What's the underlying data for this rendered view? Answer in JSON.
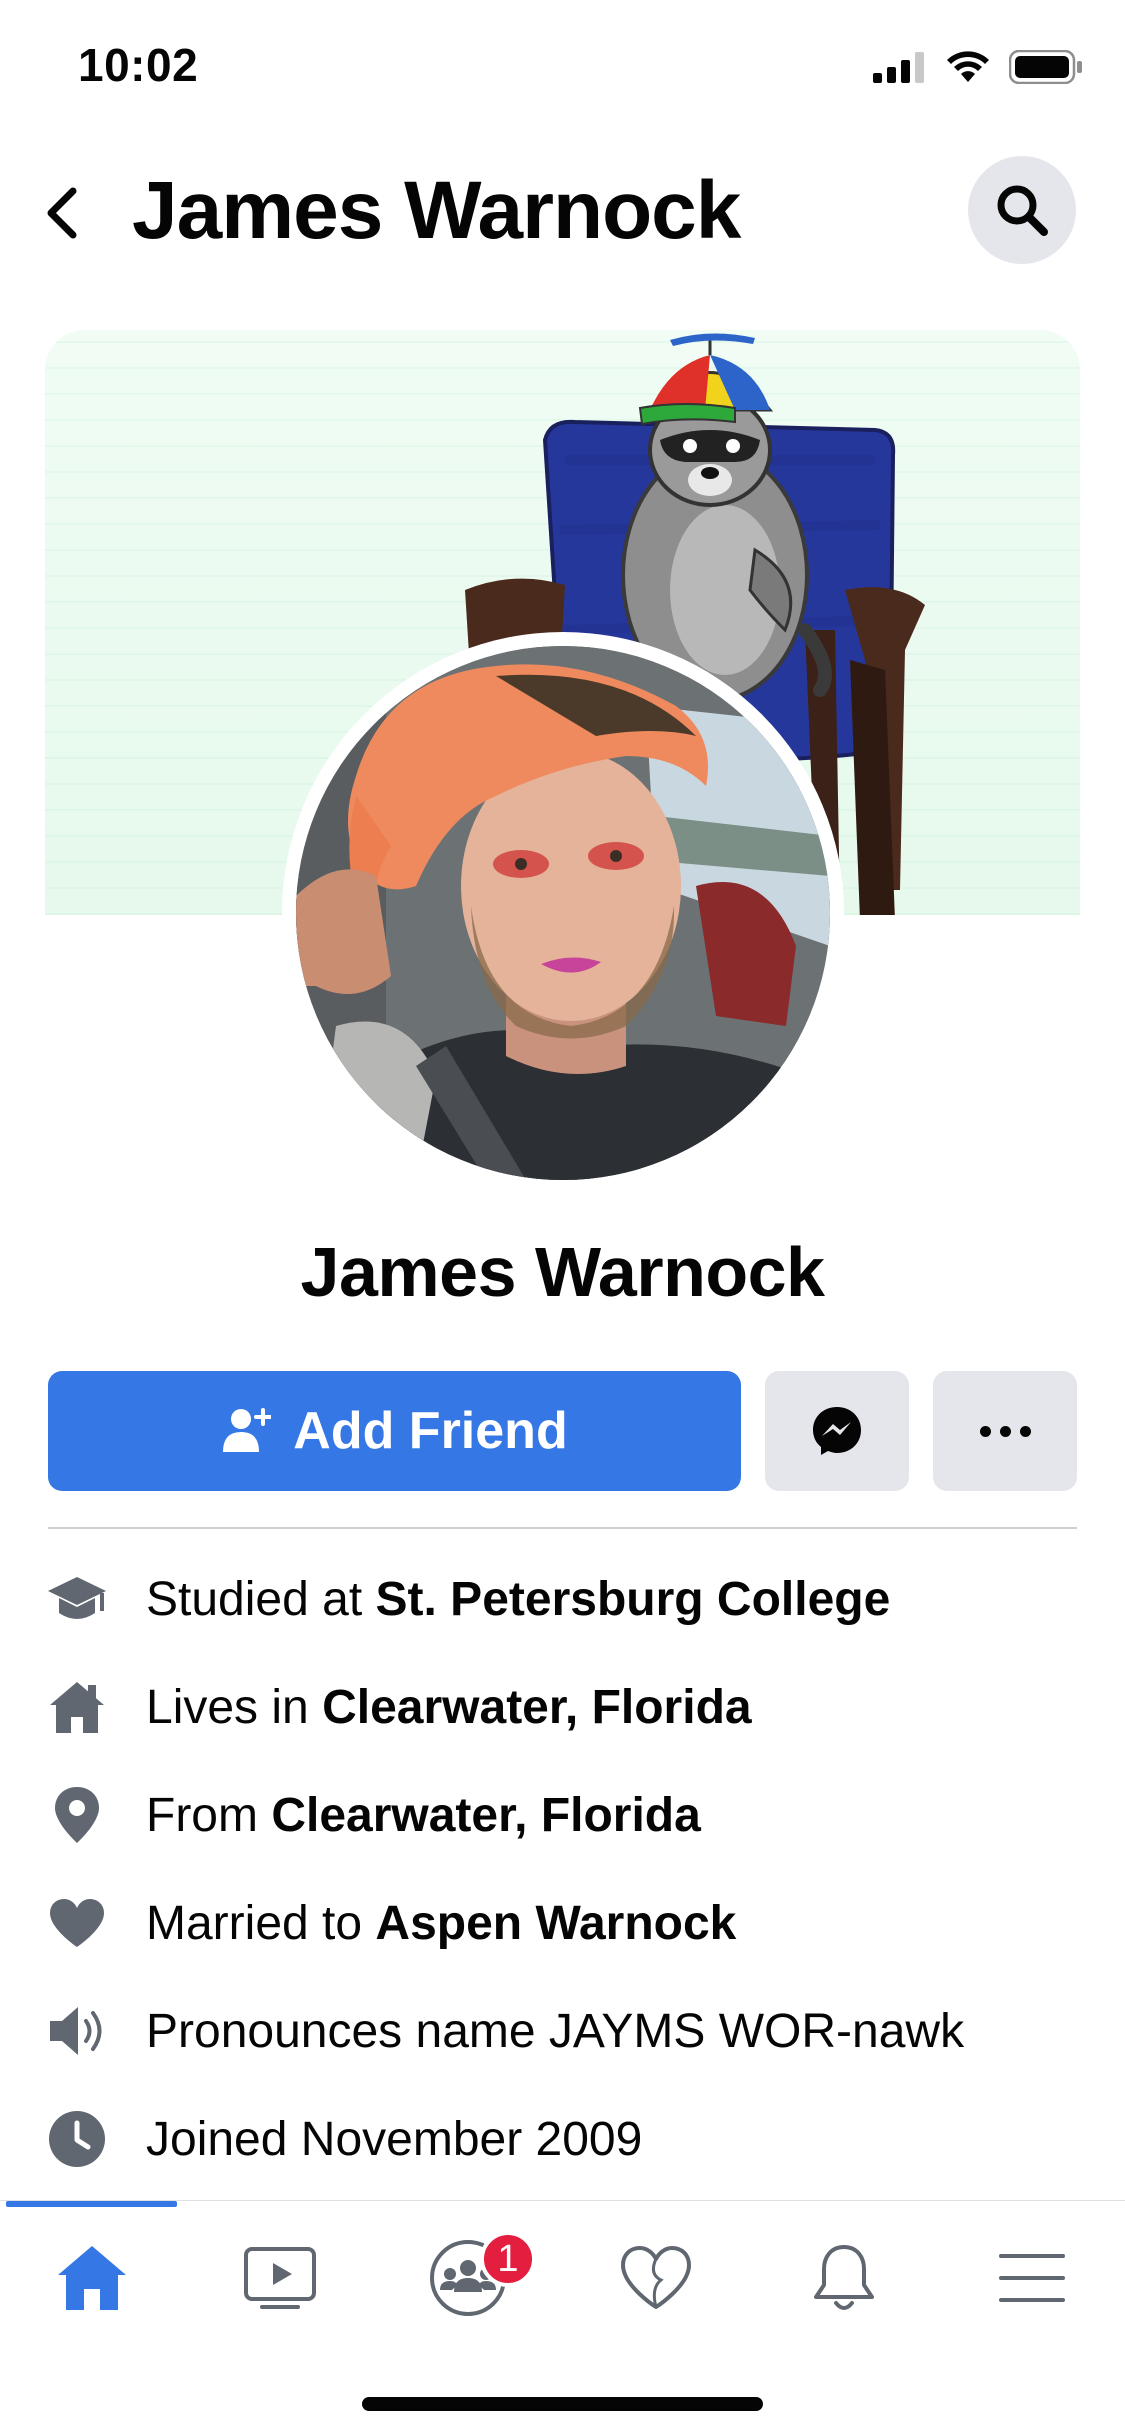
{
  "status_bar": {
    "time": "10:02",
    "icons": [
      "cellular-signal-icon",
      "wifi-icon",
      "battery-icon"
    ]
  },
  "header": {
    "back_icon": "chevron-left-icon",
    "title": "James Warnock",
    "search_icon": "search-icon"
  },
  "profile": {
    "name": "James Warnock"
  },
  "actions": {
    "add_friend_label": "Add Friend",
    "add_friend_icon": "add-person-icon",
    "message_icon": "messenger-icon",
    "more_icon": "more-dots-icon"
  },
  "details": [
    {
      "icon": "graduation-cap-icon",
      "prefix": "Studied at ",
      "bold": "St. Petersburg College"
    },
    {
      "icon": "home-icon",
      "prefix": "Lives in ",
      "bold": "Clearwater, Florida"
    },
    {
      "icon": "location-pin-icon",
      "prefix": "From ",
      "bold": "Clearwater, Florida"
    },
    {
      "icon": "heart-icon",
      "prefix": "Married to ",
      "bold": "Aspen Warnock"
    },
    {
      "icon": "speaker-icon",
      "prefix": "Pronounces name JAYMS WOR-nawk",
      "bold": ""
    },
    {
      "icon": "clock-icon",
      "prefix": "Joined November 2009",
      "bold": ""
    }
  ],
  "bottom_nav": {
    "active": "home",
    "items": [
      {
        "name": "home",
        "icon": "home-icon"
      },
      {
        "name": "watch",
        "icon": "video-icon"
      },
      {
        "name": "groups",
        "icon": "groups-icon",
        "badge": "1"
      },
      {
        "name": "dating",
        "icon": "heart-outline-icon"
      },
      {
        "name": "notifications",
        "icon": "bell-icon"
      },
      {
        "name": "menu",
        "icon": "menu-icon"
      }
    ]
  },
  "colors": {
    "accent": "#3578e5",
    "button_gray": "#e4e6eb",
    "badge_red": "#e41e3f",
    "icon_gray": "#606770"
  }
}
